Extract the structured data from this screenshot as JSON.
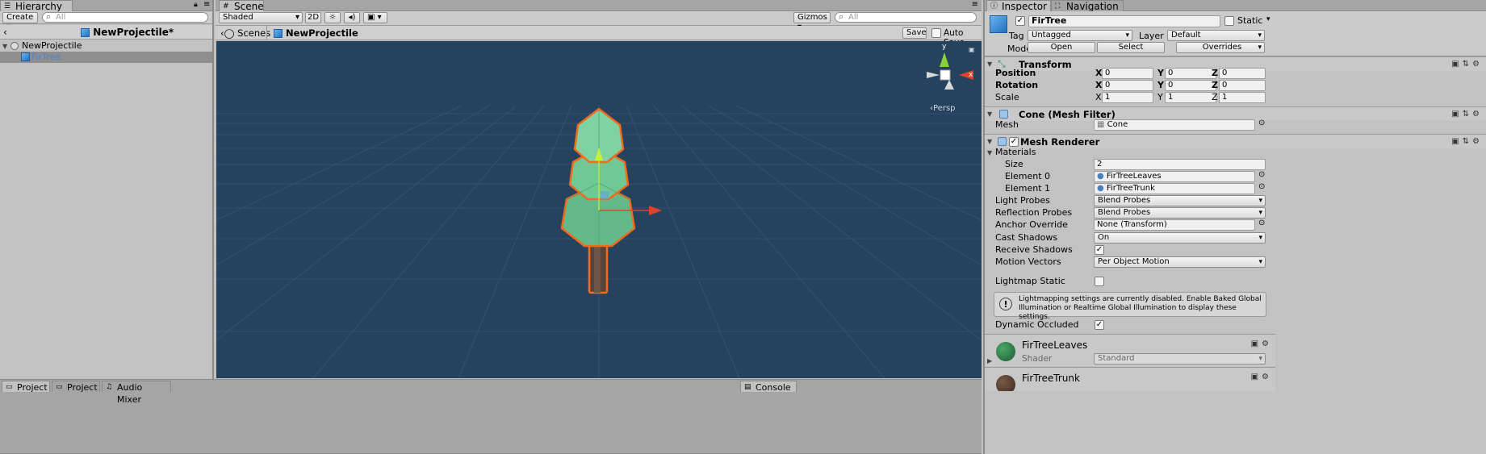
{
  "hierarchy": {
    "tab_label": "Hierarchy",
    "create_label": "Create",
    "search_placeholder": "All",
    "scene_title": "NewProjectile*",
    "items": [
      {
        "label": "NewProjectile"
      },
      {
        "label": "FirTree"
      }
    ]
  },
  "scene": {
    "tab_label": "Scene",
    "shading_mode": "Shaded",
    "mode_2d": "2D",
    "gizmos_label": "Gizmos",
    "search_placeholder": "All",
    "breadcrumb_root": "Scenes",
    "breadcrumb_prefab": "NewProjectile",
    "save_label": "Save",
    "autosave_label": "Auto Save",
    "persp_label": "Persp",
    "axis_y": "y",
    "axis_x": "x"
  },
  "inspector": {
    "tabs": [
      "Inspector",
      "Navigation"
    ],
    "object_name": "FirTree",
    "static_label": "Static",
    "tag_label": "Tag",
    "tag_value": "Untagged",
    "layer_label": "Layer",
    "layer_value": "Default",
    "model_label": "Model",
    "open_label": "Open",
    "select_label": "Select",
    "overrides_label": "Overrides",
    "transform": {
      "title": "Transform",
      "position_label": "Position",
      "rotation_label": "Rotation",
      "scale_label": "Scale",
      "x": "X",
      "y": "Y",
      "z": "Z",
      "position": [
        "0",
        "0",
        "0"
      ],
      "rotation": [
        "0",
        "0",
        "0"
      ],
      "scale": [
        "1",
        "1",
        "1"
      ]
    },
    "mesh_filter": {
      "title": "Cone (Mesh Filter)",
      "mesh_label": "Mesh",
      "mesh_value": "Cone"
    },
    "mesh_renderer": {
      "title": "Mesh Renderer",
      "materials_label": "Materials",
      "size_label": "Size",
      "size_value": "2",
      "element0_label": "Element 0",
      "element0_value": "FirTreeLeaves",
      "element1_label": "Element 1",
      "element1_value": "FirTreeTrunk",
      "light_probes_label": "Light Probes",
      "light_probes_value": "Blend Probes",
      "reflection_probes_label": "Reflection Probes",
      "reflection_probes_value": "Blend Probes",
      "anchor_override_label": "Anchor Override",
      "anchor_override_value": "None (Transform)",
      "cast_shadows_label": "Cast Shadows",
      "cast_shadows_value": "On",
      "receive_shadows_label": "Receive Shadows",
      "motion_vectors_label": "Motion Vectors",
      "motion_vectors_value": "Per Object Motion",
      "lightmap_static_label": "Lightmap Static",
      "info_text": "Lightmapping settings are currently disabled. Enable Baked Global Illumination or Realtime Global Illumination to display these settings.",
      "dynamic_occluded_label": "Dynamic Occluded"
    },
    "material1": {
      "name": "FirTreeLeaves",
      "shader_label": "Shader",
      "shader_value": "Standard"
    },
    "material2": {
      "name": "FirTreeTrunk"
    }
  },
  "bottom_tabs": [
    "Project",
    "Project",
    "Audio Mixer"
  ],
  "console_tab": "Console",
  "colors": {
    "scene_bg": "#25435f",
    "leaves": "#6fc796",
    "selection_outline": "#f36a1d",
    "trunk": "#5a4438"
  }
}
